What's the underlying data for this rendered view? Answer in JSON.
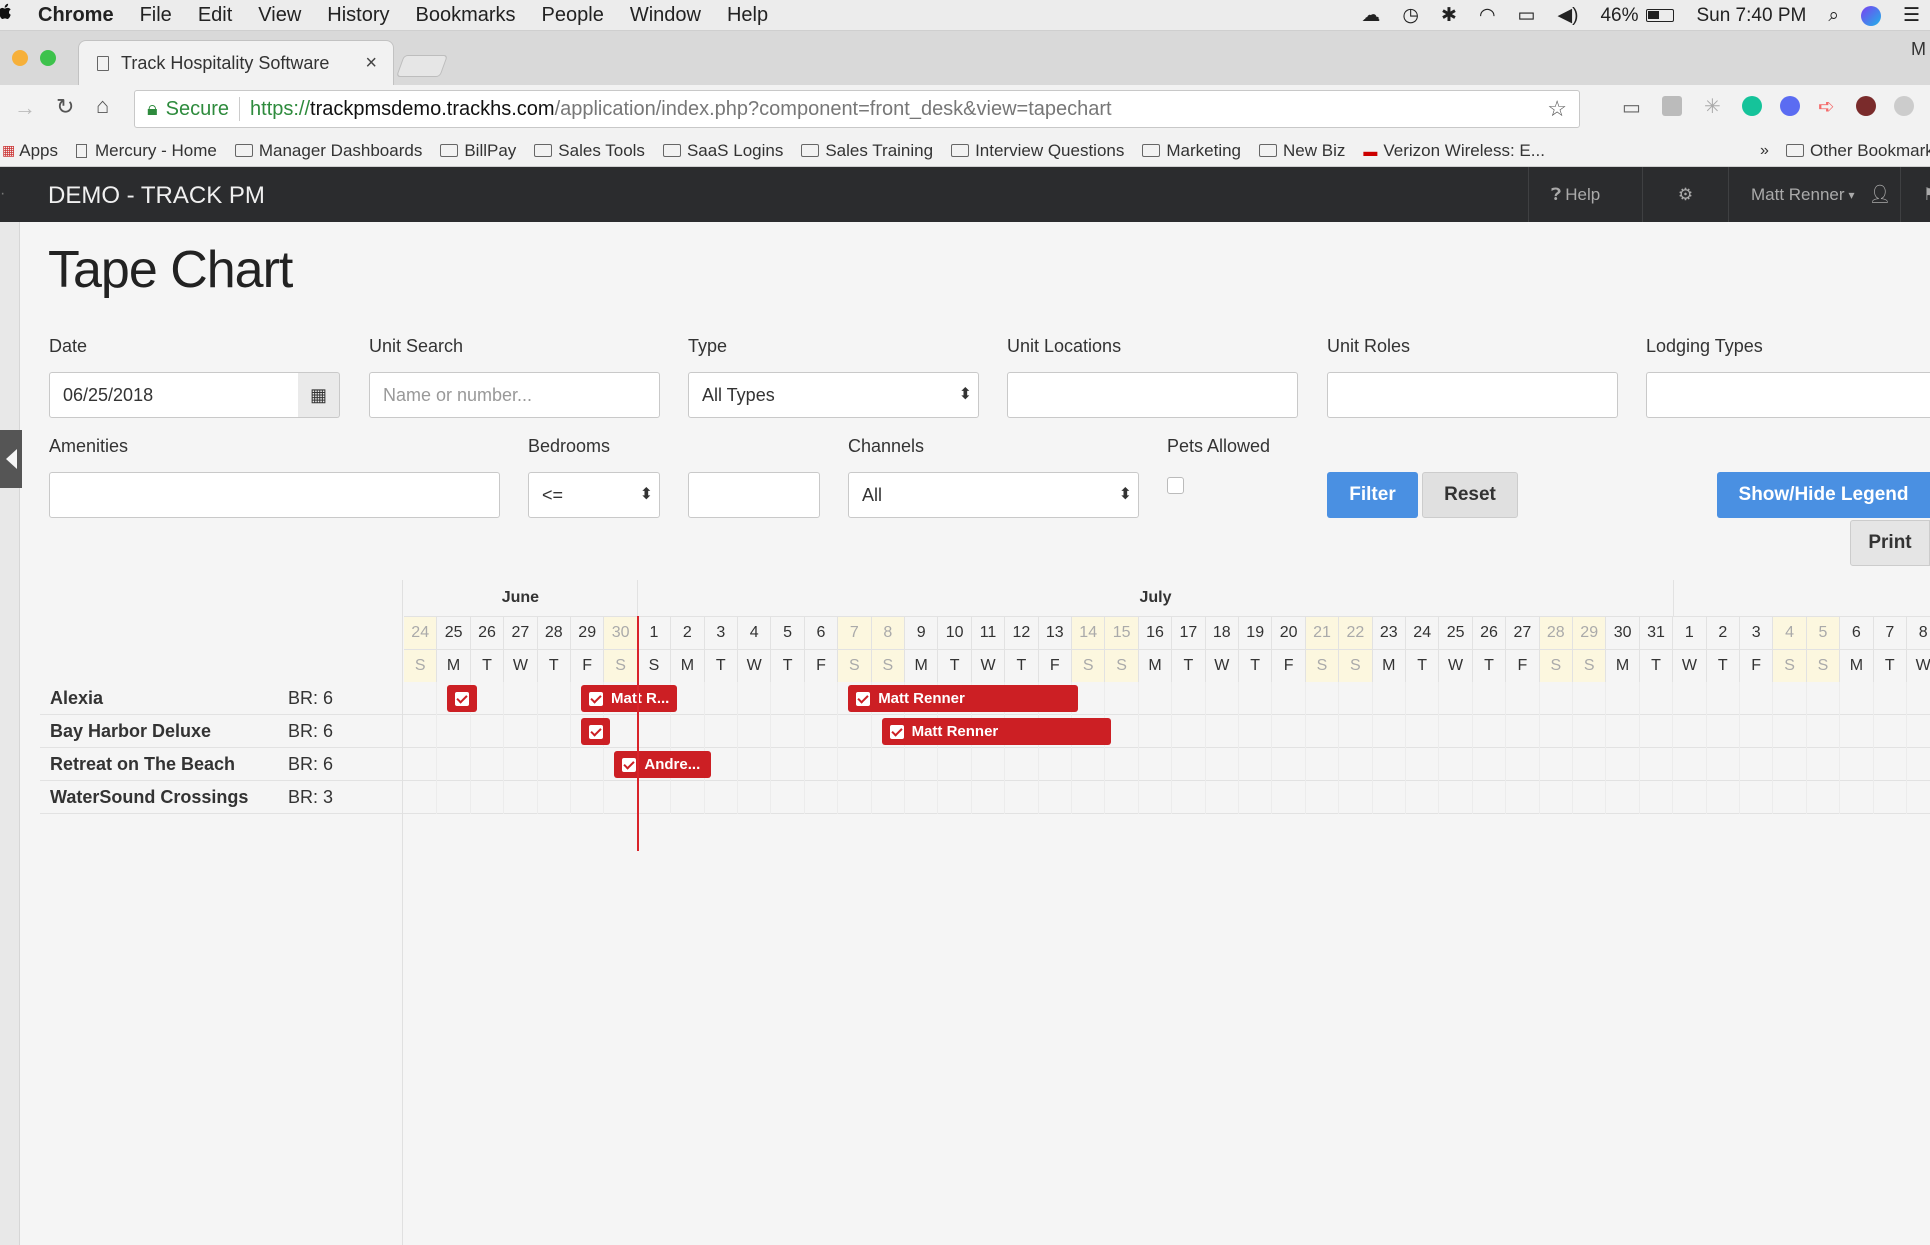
{
  "mac_menu": {
    "app": "Chrome",
    "items": [
      "File",
      "Edit",
      "View",
      "History",
      "Bookmarks",
      "People",
      "Window",
      "Help"
    ],
    "battery": "46%",
    "clock": "Sun 7:40 PM"
  },
  "browser": {
    "tab_title": "Track Hospitality Software",
    "secure_label": "Secure",
    "url_scheme": "https://",
    "url_host": "trackpmsdemo.trackhs.com",
    "url_path": "/application/index.php?component=front_desk&view=tapechart",
    "bookmarks": [
      "Apps",
      "Mercury - Home",
      "Manager Dashboards",
      "BillPay",
      "Sales Tools",
      "SaaS Logins",
      "Sales Training",
      "Interview Questions",
      "Marketing",
      "New Biz",
      "Verizon Wireless: E..."
    ],
    "other_bookmarks": "Other Bookmarks",
    "corner_letter": "M"
  },
  "navbar": {
    "brand": "DEMO - TRACK PM",
    "help": "Help",
    "user": "Matt Renner"
  },
  "page": {
    "title": "Tape Chart",
    "filters": {
      "date_label": "Date",
      "date_value": "06/25/2018",
      "unit_search_label": "Unit Search",
      "unit_search_placeholder": "Name or number...",
      "type_label": "Type",
      "type_value": "All Types",
      "unit_locations_label": "Unit Locations",
      "unit_roles_label": "Unit Roles",
      "lodging_types_label": "Lodging Types",
      "amenities_label": "Amenities",
      "bedrooms_label": "Bedrooms",
      "bedrooms_op": "<=",
      "channels_label": "Channels",
      "channels_value": "All",
      "pets_label": "Pets Allowed",
      "filter_btn": "Filter",
      "reset_btn": "Reset",
      "legend_btn": "Show/Hide Legend",
      "print_btn": "Print"
    }
  },
  "tapechart": {
    "months": [
      {
        "name": "June",
        "first_day_index": 0,
        "day_count": 7
      },
      {
        "name": "July",
        "first_day_index": 7,
        "day_count": 31
      }
    ],
    "days": [
      {
        "d": "24",
        "w": "S",
        "we": true
      },
      {
        "d": "25",
        "w": "M"
      },
      {
        "d": "26",
        "w": "T"
      },
      {
        "d": "27",
        "w": "W"
      },
      {
        "d": "28",
        "w": "T"
      },
      {
        "d": "29",
        "w": "F"
      },
      {
        "d": "30",
        "w": "S",
        "we": true
      },
      {
        "d": "1",
        "w": "S"
      },
      {
        "d": "2",
        "w": "M"
      },
      {
        "d": "3",
        "w": "T"
      },
      {
        "d": "4",
        "w": "W"
      },
      {
        "d": "5",
        "w": "T"
      },
      {
        "d": "6",
        "w": "F"
      },
      {
        "d": "7",
        "w": "S",
        "we": true
      },
      {
        "d": "8",
        "w": "S",
        "we": true
      },
      {
        "d": "9",
        "w": "M"
      },
      {
        "d": "10",
        "w": "T"
      },
      {
        "d": "11",
        "w": "W"
      },
      {
        "d": "12",
        "w": "T"
      },
      {
        "d": "13",
        "w": "F"
      },
      {
        "d": "14",
        "w": "S",
        "we": true
      },
      {
        "d": "15",
        "w": "S",
        "we": true
      },
      {
        "d": "16",
        "w": "M"
      },
      {
        "d": "17",
        "w": "T"
      },
      {
        "d": "18",
        "w": "W"
      },
      {
        "d": "19",
        "w": "T"
      },
      {
        "d": "20",
        "w": "F"
      },
      {
        "d": "21",
        "w": "S",
        "we": true
      },
      {
        "d": "22",
        "w": "S",
        "we": true
      },
      {
        "d": "23",
        "w": "M"
      },
      {
        "d": "24",
        "w": "T"
      },
      {
        "d": "25",
        "w": "W"
      },
      {
        "d": "26",
        "w": "T"
      },
      {
        "d": "27",
        "w": "F"
      },
      {
        "d": "28",
        "w": "S",
        "we": true
      },
      {
        "d": "29",
        "w": "S",
        "we": true
      },
      {
        "d": "30",
        "w": "M"
      },
      {
        "d": "31",
        "w": "T"
      },
      {
        "d": "1",
        "w": "W"
      },
      {
        "d": "2",
        "w": "T"
      },
      {
        "d": "3",
        "w": "F"
      },
      {
        "d": "4",
        "w": "S",
        "we": true
      },
      {
        "d": "5",
        "w": "S",
        "we": true
      },
      {
        "d": "6",
        "w": "M"
      },
      {
        "d": "7",
        "w": "T"
      },
      {
        "d": "8",
        "w": "W"
      }
    ],
    "units": [
      {
        "name": "Alexia",
        "br": "BR: 6"
      },
      {
        "name": "Bay Harbor Deluxe",
        "br": "BR: 6"
      },
      {
        "name": "Retreat on The Beach",
        "br": "BR: 6"
      },
      {
        "name": "WaterSound Crossings",
        "br": "BR: 3"
      }
    ],
    "reservations": [
      {
        "row": 0,
        "start": 1,
        "nights": 1,
        "label": ""
      },
      {
        "row": 0,
        "start": 5,
        "nights": 3,
        "label": "Matt R..."
      },
      {
        "row": 0,
        "start": 13,
        "nights": 7,
        "label": "Matt Renner"
      },
      {
        "row": 1,
        "start": 5,
        "nights": 1,
        "label": ""
      },
      {
        "row": 1,
        "start": 14,
        "nights": 7,
        "label": "Matt Renner"
      },
      {
        "row": 2,
        "start": 6,
        "nights": 3,
        "label": "Andre..."
      }
    ],
    "today_index": 7
  }
}
